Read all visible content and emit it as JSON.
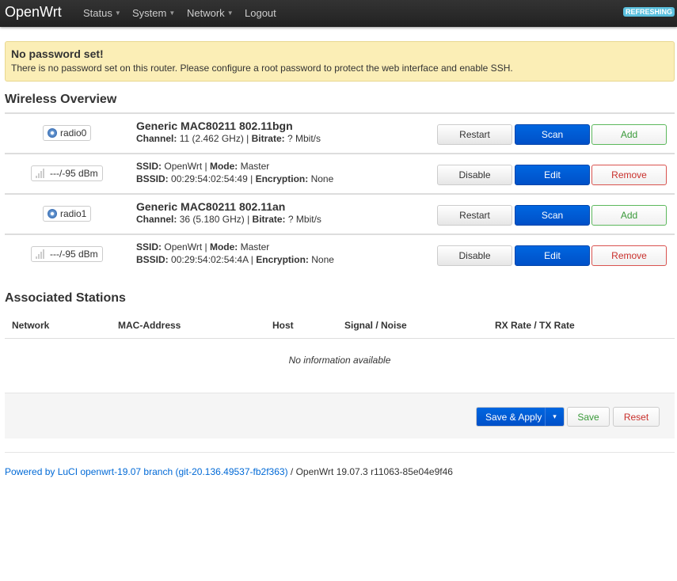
{
  "nav": {
    "brand": "OpenWrt",
    "items": [
      "Status",
      "System",
      "Network",
      "Logout"
    ],
    "status": "REFRESHING"
  },
  "alert": {
    "title": "No password set!",
    "text": "There is no password set on this router. Please configure a root password to protect the web interface and enable SSH."
  },
  "wireless": {
    "title": "Wireless Overview",
    "radios": [
      {
        "name": "radio0",
        "model": "Generic MAC80211 802.11bgn",
        "channel": "11 (2.462 GHz)",
        "bitrate": "? Mbit/s",
        "iface": {
          "signal": "---/-95 dBm",
          "ssid": "OpenWrt",
          "mode": "Master",
          "bssid": "00:29:54:02:54:49",
          "encryption": "None"
        }
      },
      {
        "name": "radio1",
        "model": "Generic MAC80211 802.11an",
        "channel": "36 (5.180 GHz)",
        "bitrate": "? Mbit/s",
        "iface": {
          "signal": "---/-95 dBm",
          "ssid": "OpenWrt",
          "mode": "Master",
          "bssid": "00:29:54:02:54:4A",
          "encryption": "None"
        }
      }
    ],
    "labels": {
      "channel": "Channel:",
      "bitrate": "Bitrate:",
      "ssid": "SSID:",
      "mode": "Mode:",
      "bssid": "BSSID:",
      "encryption": "Encryption:",
      "sep": " | "
    },
    "buttons": {
      "restart": "Restart",
      "scan": "Scan",
      "add": "Add",
      "disable": "Disable",
      "edit": "Edit",
      "remove": "Remove"
    }
  },
  "stations": {
    "title": "Associated Stations",
    "columns": [
      "Network",
      "MAC-Address",
      "Host",
      "Signal / Noise",
      "RX Rate / TX Rate"
    ],
    "empty": "No information available"
  },
  "actions": {
    "save_apply": "Save & Apply",
    "dropdown": "▾",
    "save": "Save",
    "reset": "Reset"
  },
  "footer": {
    "link": "Powered by LuCI openwrt-19.07 branch (git-20.136.49537-fb2f363)",
    "text": " / OpenWrt 19.07.3 r11063-85e04e9f46"
  }
}
